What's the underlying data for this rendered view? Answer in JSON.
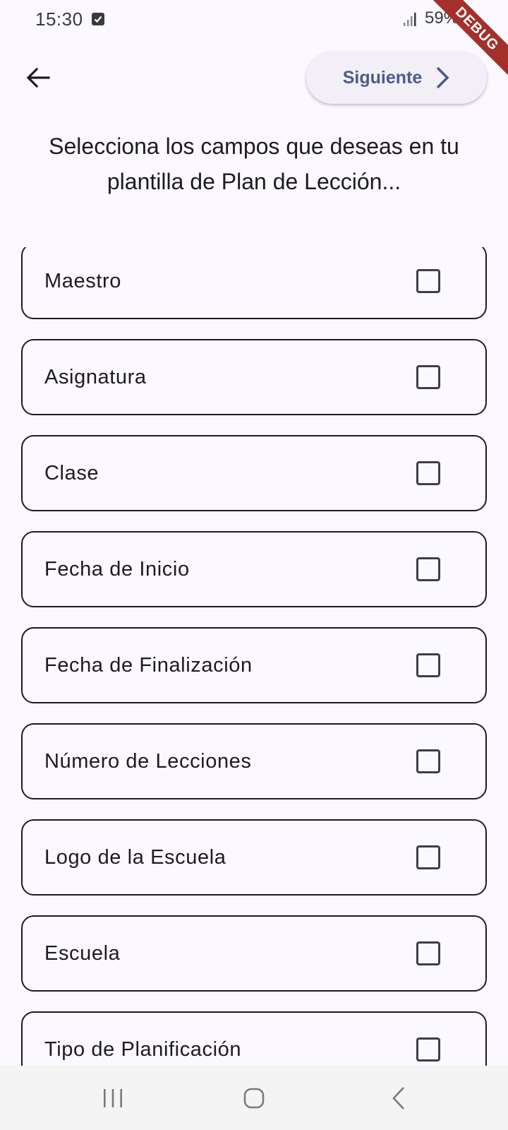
{
  "status_bar": {
    "time": "15:30",
    "battery": "59%"
  },
  "debug_banner": "DEBUG",
  "header": {
    "next_label": "Siguiente"
  },
  "title": "Selecciona los campos que deseas en tu plantilla de Plan de Lección...",
  "fields": [
    {
      "label": "Maestro",
      "checked": false
    },
    {
      "label": "Asignatura",
      "checked": false
    },
    {
      "label": "Clase",
      "checked": false
    },
    {
      "label": "Fecha de Inicio",
      "checked": false
    },
    {
      "label": "Fecha de Finalización",
      "checked": false
    },
    {
      "label": "Número de Lecciones",
      "checked": false
    },
    {
      "label": "Logo de la Escuela",
      "checked": false
    },
    {
      "label": "Escuela",
      "checked": false
    },
    {
      "label": "Tipo de Planificación",
      "checked": false
    }
  ],
  "colors": {
    "background": "#fbf8ff",
    "accent": "#4f5a8a",
    "button_bg": "#f2eff6",
    "debug": "#a3302b"
  },
  "icons": {
    "back": "arrow-back-icon",
    "next": "chevron-right-icon",
    "nav_recents": "recents-icon",
    "nav_home": "home-icon",
    "nav_back": "nav-back-icon"
  }
}
